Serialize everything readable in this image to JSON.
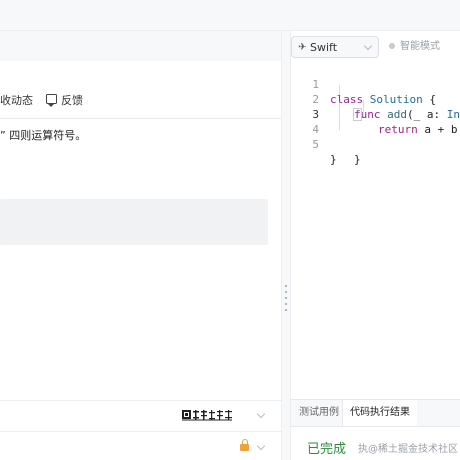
{
  "problem_panel": {
    "tab_activity": "收动态",
    "tab_feedback": "反馈",
    "description_fragment": "” 四则运算符号。"
  },
  "editor": {
    "language": "Swift",
    "smart_mode_label": "智能模式",
    "lines": [
      {
        "num": "1"
      },
      {
        "num": "2"
      },
      {
        "num": "3"
      },
      {
        "num": "4"
      },
      {
        "num": "5"
      }
    ],
    "tokens": {
      "l1_kw": "class",
      "l1_name": "Solution",
      "l1_brace": "{",
      "l2_kw": "func",
      "l2_name": "add",
      "l2_params_a": "(_ a: ",
      "l2_type": "Int",
      "l2_comma": ",",
      "l3_kw": "return",
      "l3_expr": "a + b",
      "l4_brace": "}",
      "l5_brace": "}"
    }
  },
  "bottom_panel": {
    "tab_testcases": "测试用例",
    "tab_results": "代码执行结果",
    "result_status": "已完成",
    "watermark": "执@稀土掘金技术社区"
  },
  "icons": {
    "feedback": "feedback-icon",
    "swift": "swift-logo-icon",
    "lock": "lock-icon",
    "publisher_logo": "publisher-logo"
  },
  "colors": {
    "result_green": "#2e8b3e",
    "lock_orange": "#f0a33a",
    "keyword_purple": "#9b2393",
    "type_blue": "#1f6f9c"
  }
}
